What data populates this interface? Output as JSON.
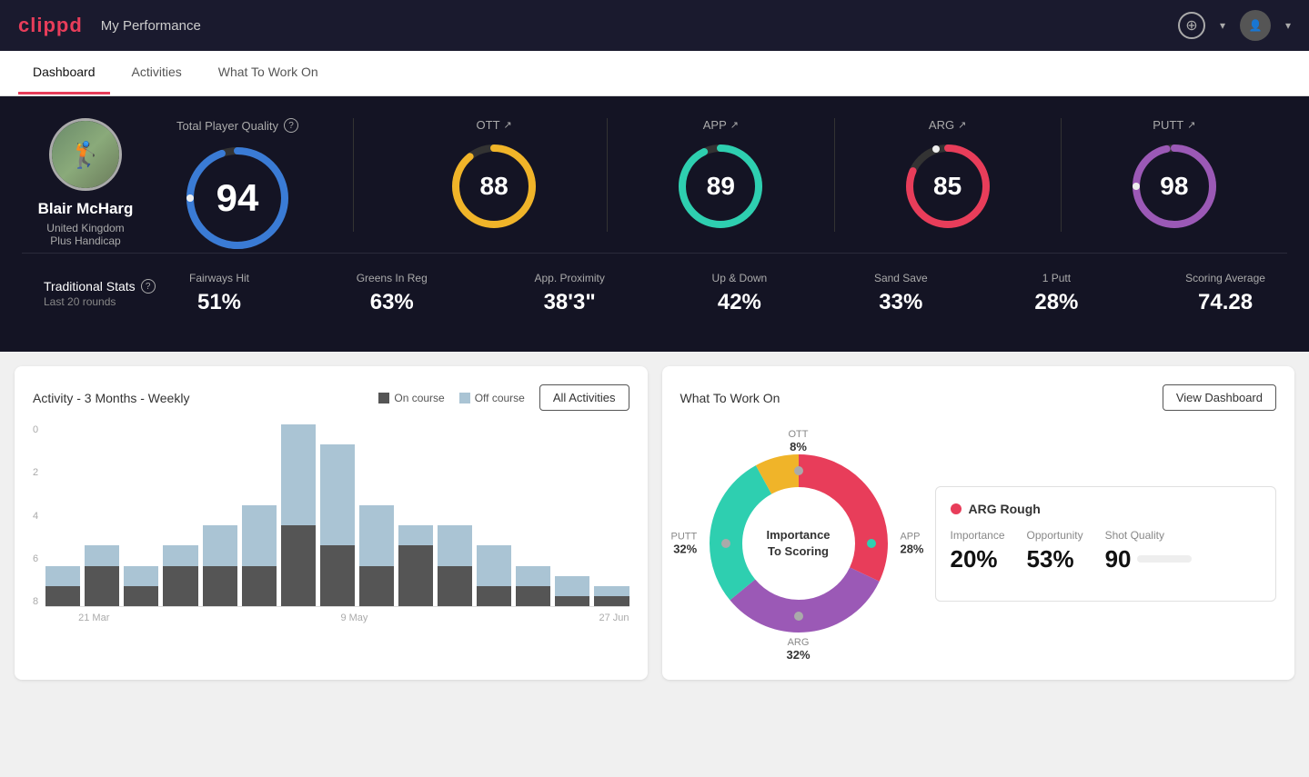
{
  "header": {
    "logo": "clippd",
    "title": "My Performance",
    "add_icon": "+",
    "avatar_icon": "👤"
  },
  "nav": {
    "tabs": [
      {
        "label": "Dashboard",
        "active": true
      },
      {
        "label": "Activities",
        "active": false
      },
      {
        "label": "What To Work On",
        "active": false
      }
    ]
  },
  "player": {
    "name": "Blair McHarg",
    "country": "United Kingdom",
    "handicap": "Plus Handicap"
  },
  "scores": {
    "total": {
      "label": "Total Player Quality",
      "value": "94",
      "color": "#3a7bd5"
    },
    "ott": {
      "label": "OTT",
      "value": "88",
      "color": "#f0b429"
    },
    "app": {
      "label": "APP",
      "value": "89",
      "color": "#2ecfb0"
    },
    "arg": {
      "label": "ARG",
      "value": "85",
      "color": "#e83d5a"
    },
    "putt": {
      "label": "PUTT",
      "value": "98",
      "color": "#9b59b6"
    }
  },
  "traditional_stats": {
    "title": "Traditional Stats",
    "subtitle": "Last 20 rounds",
    "items": [
      {
        "label": "Fairways Hit",
        "value": "51%"
      },
      {
        "label": "Greens In Reg",
        "value": "63%"
      },
      {
        "label": "App. Proximity",
        "value": "38'3\""
      },
      {
        "label": "Up & Down",
        "value": "42%"
      },
      {
        "label": "Sand Save",
        "value": "33%"
      },
      {
        "label": "1 Putt",
        "value": "28%"
      },
      {
        "label": "Scoring Average",
        "value": "74.28"
      }
    ]
  },
  "activity_chart": {
    "title": "Activity - 3 Months - Weekly",
    "legend": {
      "on_course": "On course",
      "off_course": "Off course"
    },
    "all_activities_btn": "All Activities",
    "y_labels": [
      "0",
      "2",
      "4",
      "6",
      "8"
    ],
    "x_labels": [
      "21 Mar",
      "9 May",
      "27 Jun"
    ],
    "bars": [
      {
        "on": 1,
        "off": 1
      },
      {
        "on": 2,
        "off": 1
      },
      {
        "on": 1,
        "off": 1
      },
      {
        "on": 2,
        "off": 1
      },
      {
        "on": 2,
        "off": 2
      },
      {
        "on": 2,
        "off": 3
      },
      {
        "on": 4,
        "off": 5
      },
      {
        "on": 3,
        "off": 5
      },
      {
        "on": 2,
        "off": 3
      },
      {
        "on": 3,
        "off": 1
      },
      {
        "on": 2,
        "off": 2
      },
      {
        "on": 1,
        "off": 2
      },
      {
        "on": 1,
        "off": 1
      },
      {
        "on": 0.5,
        "off": 1
      },
      {
        "on": 0.5,
        "off": 0.5
      }
    ]
  },
  "what_to_work_on": {
    "title": "What To Work On",
    "view_dashboard_btn": "View Dashboard",
    "donut_center": "Importance\nTo Scoring",
    "segments": [
      {
        "label": "OTT",
        "value": "8%",
        "color": "#f0b429",
        "position": "top"
      },
      {
        "label": "APP",
        "value": "28%",
        "color": "#2ecfb0",
        "position": "right"
      },
      {
        "label": "ARG",
        "value": "32%",
        "color": "#e83d5a",
        "position": "bottom"
      },
      {
        "label": "PUTT",
        "value": "32%",
        "color": "#9b59b6",
        "position": "left"
      }
    ],
    "detail_card": {
      "title": "ARG Rough",
      "dot_color": "#e83d5a",
      "metrics": [
        {
          "label": "Importance",
          "value": "20%"
        },
        {
          "label": "Opportunity",
          "value": "53%"
        },
        {
          "label": "Shot Quality",
          "value": "90"
        }
      ]
    }
  },
  "colors": {
    "accent": "#e83d5a",
    "dark_bg": "#141424",
    "card_bg": "#fff"
  }
}
